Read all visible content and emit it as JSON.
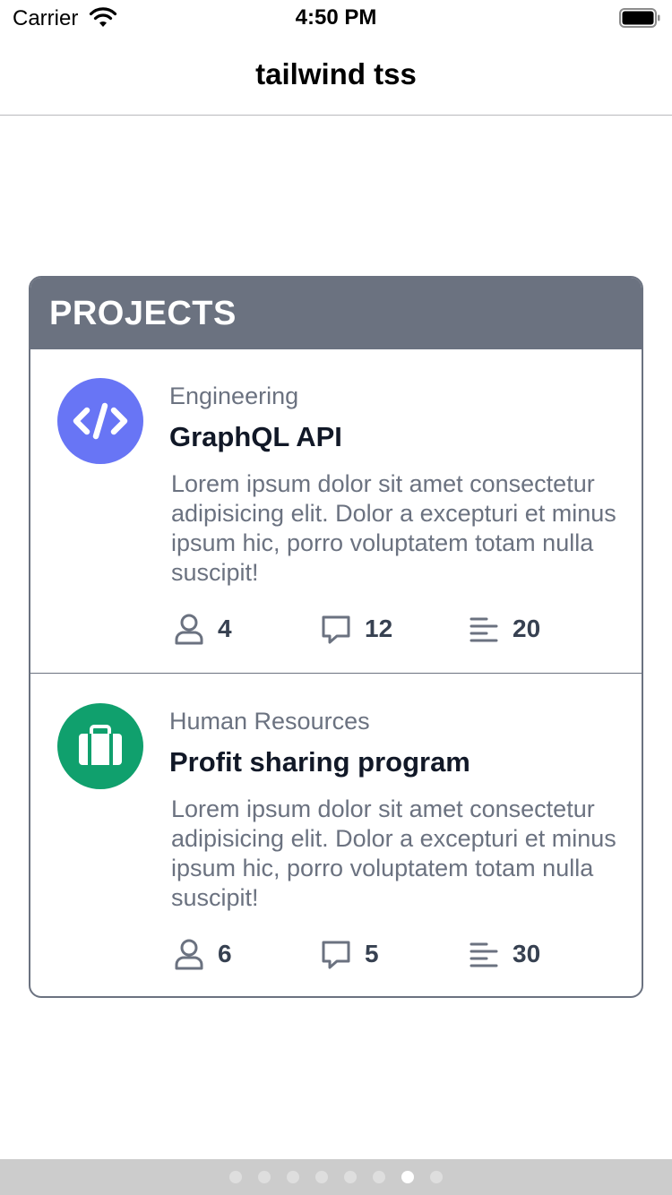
{
  "status_bar": {
    "carrier": "Carrier",
    "time": "4:50 PM",
    "icons": [
      "wifi-icon",
      "battery-icon"
    ]
  },
  "nav": {
    "title": "tailwind tss"
  },
  "card": {
    "title": "PROJECTS",
    "projects": [
      {
        "category": "Engineering",
        "title": "GraphQL API",
        "description": "Lorem ipsum dolor sit amet consectetur adipisicing elit. Dolor a excepturi et minus ipsum hic, porro voluptatem totam nulla suscipit!",
        "icon": "code-icon",
        "icon_color": "#6875f5",
        "stats": {
          "members": "4",
          "comments": "12",
          "tasks": "20"
        }
      },
      {
        "category": "Human Resources",
        "title": "Profit sharing program",
        "description": "Lorem ipsum dolor sit amet consectetur adipisicing elit. Dolor a excepturi et minus ipsum hic, porro voluptatem totam nulla suscipit!",
        "icon": "briefcase-icon",
        "icon_color": "#10a06d",
        "stats": {
          "members": "6",
          "comments": "5",
          "tasks": "30"
        }
      }
    ]
  },
  "stat_icons": [
    "user-icon",
    "chat-icon",
    "list-icon"
  ],
  "pager": {
    "total_pages": 8,
    "current_page": 7
  },
  "colors": {
    "header_bg": "#6b7280",
    "muted_text": "#6b7280",
    "stat_text": "#374151",
    "pager_bg": "#cccccc"
  }
}
